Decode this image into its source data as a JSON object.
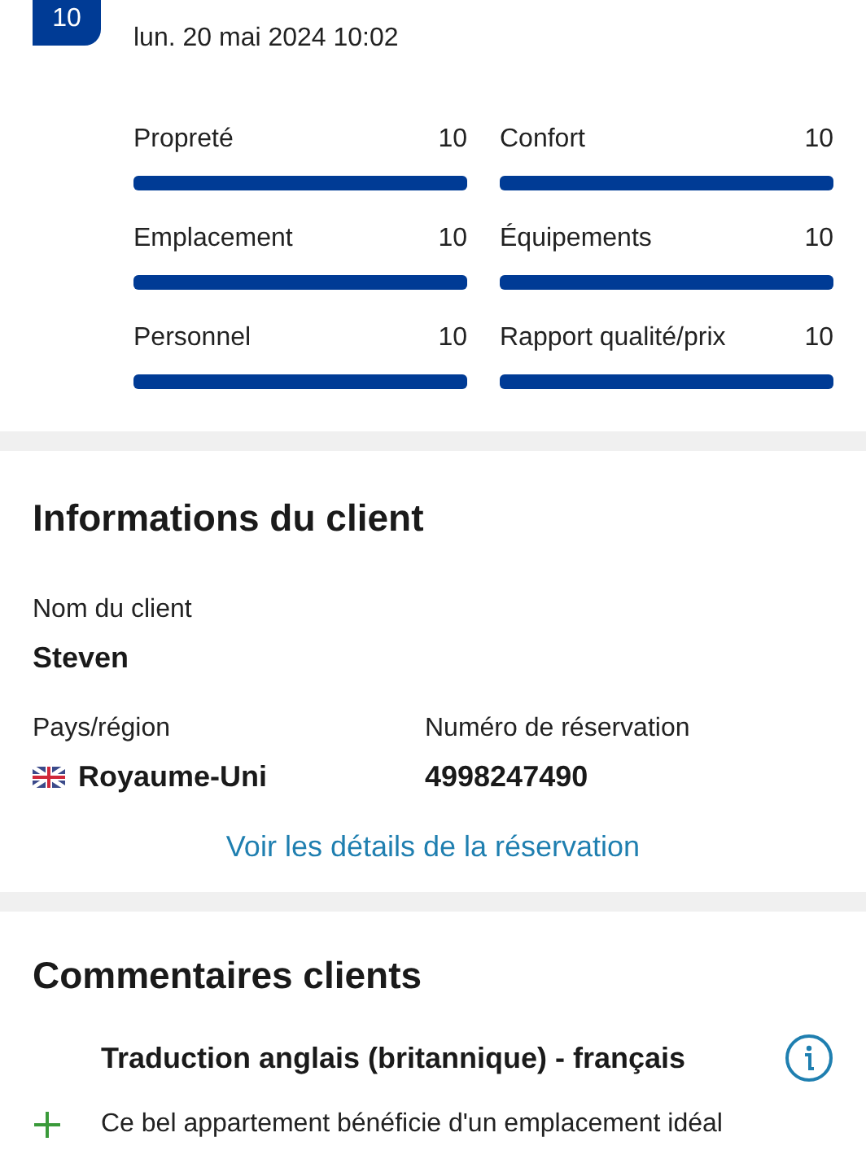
{
  "review": {
    "score": "10",
    "date": "lun. 20 mai 2024 10:02",
    "ratings": [
      {
        "label": "Propreté",
        "value": "10",
        "level": 1
      },
      {
        "label": "Confort",
        "value": "10",
        "level": 1
      },
      {
        "label": "Emplacement",
        "value": "10",
        "level": 1
      },
      {
        "label": "Équipements",
        "value": "10",
        "level": 1
      },
      {
        "label": "Personnel",
        "value": "10",
        "level": 1
      },
      {
        "label": "Rapport qualité/prix",
        "value": "10",
        "level": 1
      }
    ]
  },
  "client": {
    "title": "Informations du client",
    "name_label": "Nom du client",
    "name": "Steven",
    "country_label": "Pays/région",
    "country": "Royaume-Uni",
    "booking_label": "Numéro de réservation",
    "booking": "4998247490",
    "link": "Voir les détails de la réservation"
  },
  "comments": {
    "title": "Commentaires clients",
    "translation": "Traduction anglais (britannique) - français",
    "items": [
      {
        "kind": "positive",
        "text": "Ce bel appartement bénéficie d'un emplacement idéal"
      }
    ]
  }
}
